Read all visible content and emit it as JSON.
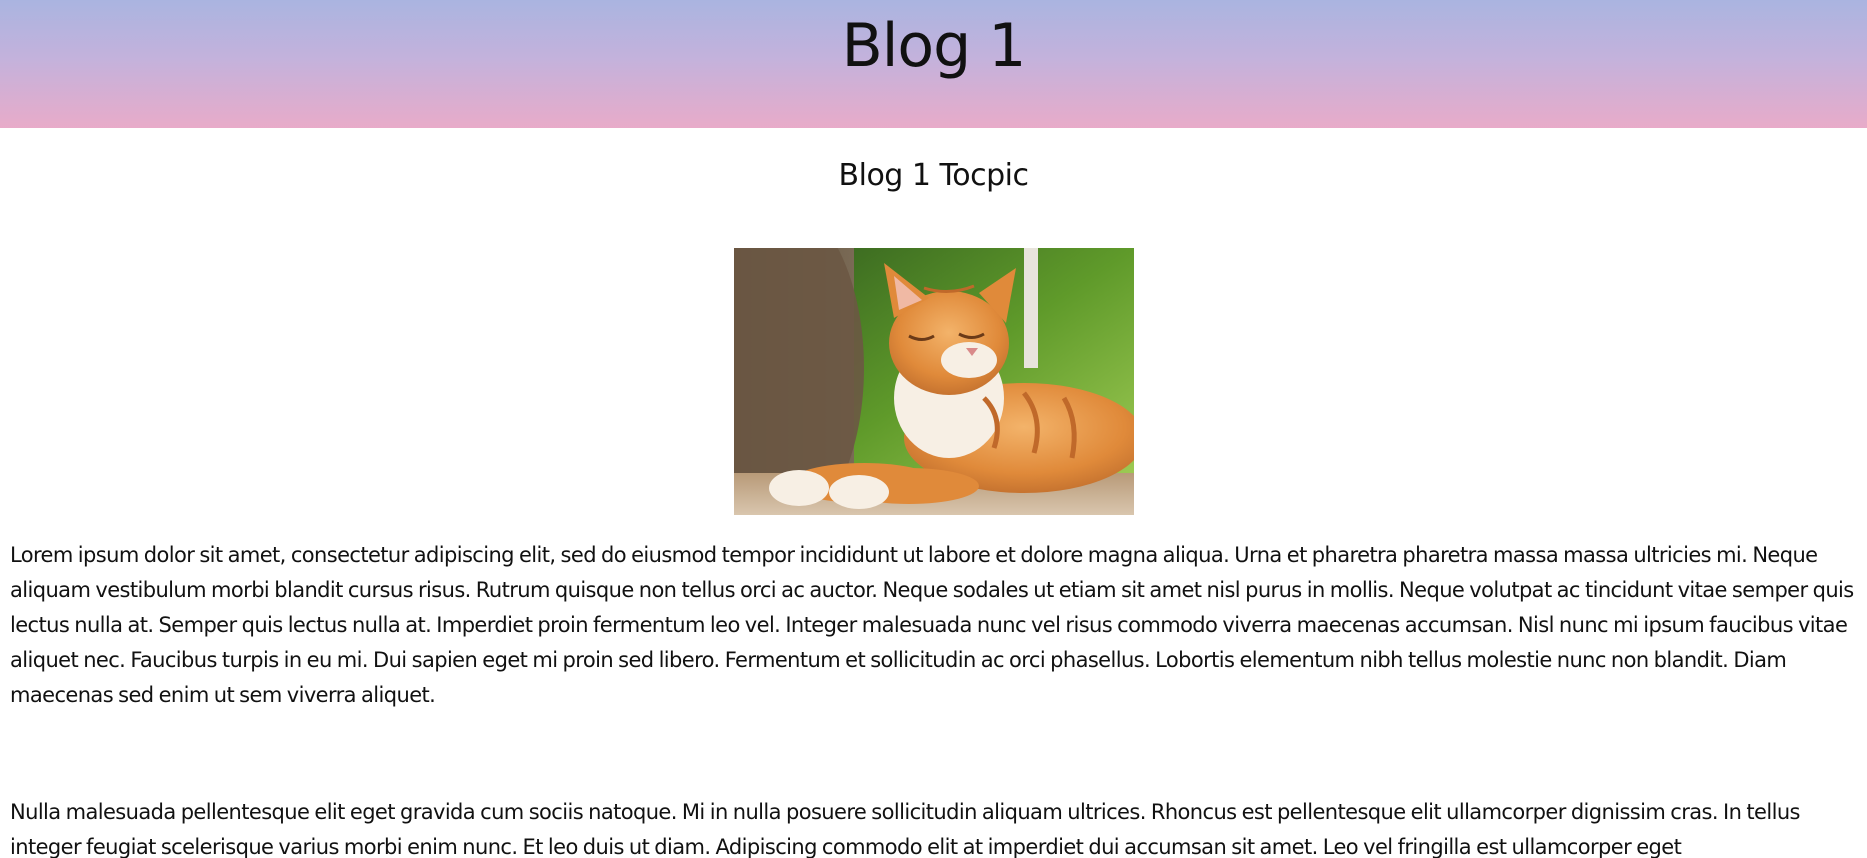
{
  "header": {
    "title": "Blog 1"
  },
  "post": {
    "topic": "Blog 1 Tocpic",
    "paragraphs": [
      "Lorem ipsum dolor sit amet, consectetur adipiscing elit, sed do eiusmod tempor incididunt ut labore et dolore magna aliqua. Urna et pharetra pharetra massa massa ultricies mi. Neque aliquam vestibulum morbi blandit cursus risus. Rutrum quisque non tellus orci ac auctor. Neque sodales ut etiam sit amet nisl purus in mollis. Neque volutpat ac tincidunt vitae semper quis lectus nulla at. Semper quis lectus nulla at. Imperdiet proin fermentum leo vel. Integer malesuada nunc vel risus commodo viverra maecenas accumsan. Nisl nunc mi ipsum faucibus vitae aliquet nec. Faucibus turpis in eu mi. Dui sapien eget mi proin sed libero. Fermentum et sollicitudin ac orci phasellus. Lobortis elementum nibh tellus molestie nunc non blandit. Diam maecenas sed enim ut sem viverra aliquet.",
      "Nulla malesuada pellentesque elit eget gravida cum sociis natoque. Mi in nulla posuere sollicitudin aliquam ultrices. Rhoncus est pellentesque elit ullamcorper dignissim cras. In tellus integer feugiat scelerisque varius morbi enim nunc. Et leo duis ut diam. Adipiscing commodo elit at imperdiet dui accumsan sit amet. Leo vel fringilla est ullamcorper eget"
    ]
  },
  "colors": {
    "header_top": "#aab4e0",
    "header_bottom": "#e8abc9",
    "text": "#111111",
    "background": "#ffffff"
  }
}
